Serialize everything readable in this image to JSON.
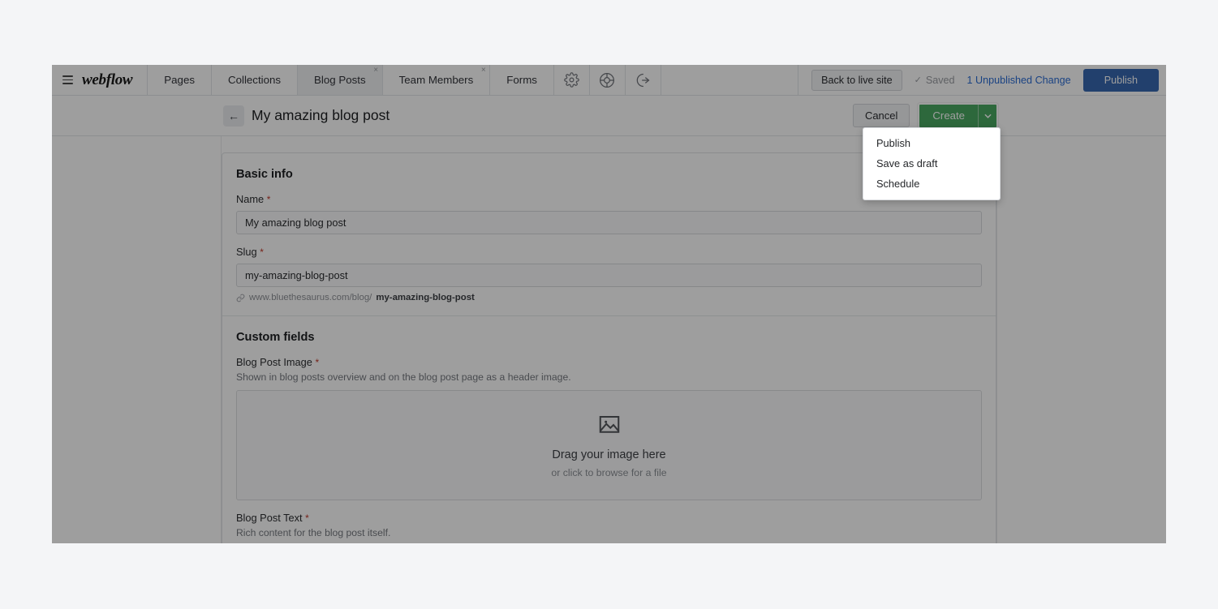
{
  "brand": {
    "name": "webflow",
    "menu_icon": "hamburger-icon"
  },
  "topbar": {
    "tabs": [
      {
        "label": "Pages",
        "active": false,
        "closable": false
      },
      {
        "label": "Collections",
        "active": false,
        "closable": false
      },
      {
        "label": "Blog Posts",
        "active": true,
        "closable": true
      },
      {
        "label": "Team Members",
        "active": false,
        "closable": true
      },
      {
        "label": "Forms",
        "active": false,
        "closable": false
      }
    ],
    "close_glyph": "×",
    "icons": [
      {
        "name": "gear-icon",
        "title": "Settings"
      },
      {
        "name": "lifebuoy-icon",
        "title": "Help"
      },
      {
        "name": "logout-icon",
        "title": "Log out"
      }
    ],
    "back_to_live_site": "Back to live site",
    "saved_label": "Saved",
    "saved_check": "✓",
    "unpublished_changes": "1 Unpublished Change",
    "publish_label": "Publish",
    "publish_color": "#3868b0",
    "unpublished_color": "#2b6cd4"
  },
  "subbar": {
    "back_arrow": "←",
    "title": "My amazing blog post",
    "cancel_label": "Cancel",
    "create_label": "Create",
    "create_caret": "⌄",
    "create_color": "#49a862"
  },
  "dropdown": {
    "items": [
      {
        "label": "Publish"
      },
      {
        "label": "Save as draft"
      },
      {
        "label": "Schedule"
      }
    ]
  },
  "form": {
    "basic_info": {
      "title": "Basic info",
      "name": {
        "label": "Name",
        "required_glyph": "*",
        "value": "My amazing blog post"
      },
      "slug": {
        "label": "Slug",
        "required_glyph": "*",
        "value": "my-amazing-blog-post",
        "hint_prefix": "www.bluethesaurus.com/blog/",
        "hint_slug": "my-amazing-blog-post",
        "link_icon": "link-icon"
      }
    },
    "custom_fields": {
      "title": "Custom fields",
      "image_field": {
        "label": "Blog Post Image",
        "required_glyph": "*",
        "help": "Shown in blog posts overview and on the blog post page as a header image.",
        "drop_title": "Drag your image here",
        "drop_sub": "or click to browse for a file",
        "icon": "image-placeholder-icon"
      },
      "text_field": {
        "label": "Blog Post Text",
        "required_glyph": "*",
        "help": "Rich content for the blog post itself.",
        "value": ""
      }
    }
  }
}
